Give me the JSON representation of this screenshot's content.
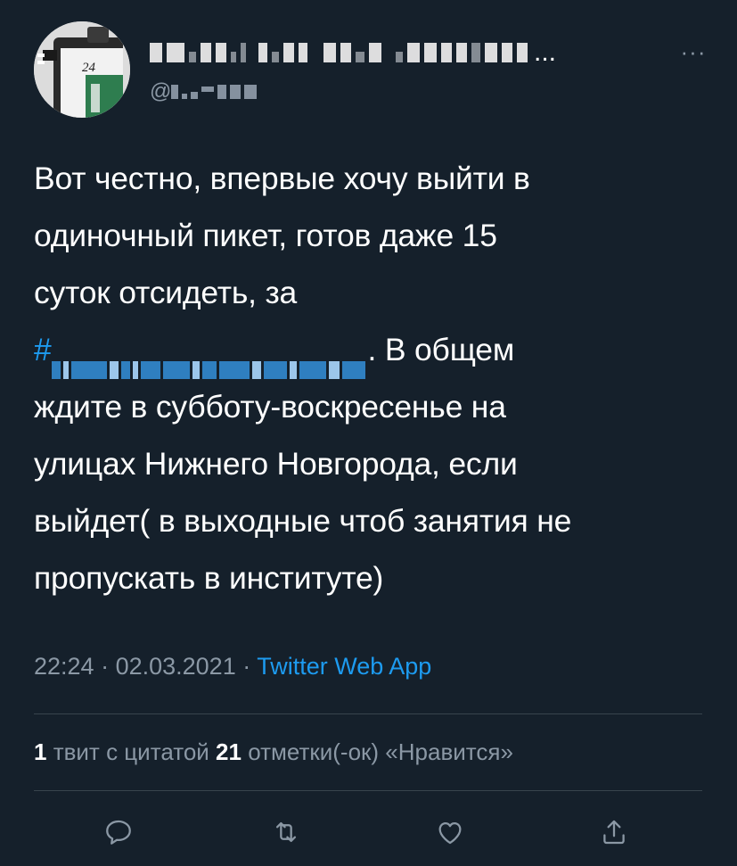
{
  "tweet": {
    "author": {
      "display_name_suffix": "...",
      "handle_prefix": "@",
      "avatar_label": "24"
    },
    "more_icon": "···",
    "text_segments": {
      "line1": "Вот честно, впервые хочу выйти в",
      "line2": "одиночный пикет, готов даже 15",
      "line3": "суток отсидеть, за",
      "hashtag_prefix": "#",
      "after_hashtag": ". В общем",
      "line5": "ждите в субботу-воскресенье на",
      "line6": "улицах Нижнего Новгорода, если",
      "line7": "выйдет( в выходные чтоб занятия не",
      "line8": "пропускать в институте)"
    },
    "time": "22:24",
    "separator": " · ",
    "date": "02.03.2021",
    "source": "Twitter Web App",
    "stats": {
      "quotes_count": "1",
      "quotes_label": " твит с цитатой ",
      "likes_count": "21",
      "likes_label": " отметки(-ок) «Нравится»"
    },
    "actions": [
      {
        "icon": "reply-icon"
      },
      {
        "icon": "retweet-icon"
      },
      {
        "icon": "like-icon"
      },
      {
        "icon": "share-icon"
      }
    ]
  },
  "colors": {
    "background": "#15202b",
    "text": "#ffffff",
    "secondary": "#8b98a5",
    "accent": "#1d9bf0",
    "divider": "#38444d"
  }
}
